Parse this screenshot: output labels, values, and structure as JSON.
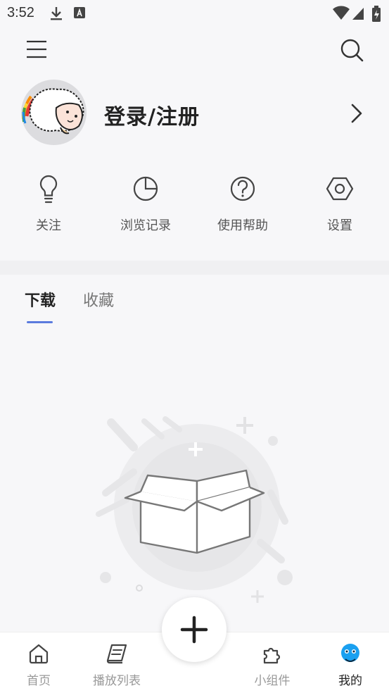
{
  "status_bar": {
    "time": "3:52"
  },
  "profile": {
    "login_label": "登录/注册"
  },
  "quick_actions": [
    {
      "label": "关注",
      "icon": "lightbulb-icon"
    },
    {
      "label": "浏览记录",
      "icon": "pie-chart-icon"
    },
    {
      "label": "使用帮助",
      "icon": "help-circle-icon"
    },
    {
      "label": "设置",
      "icon": "settings-hexagon-icon"
    }
  ],
  "tabs": [
    {
      "label": "下载",
      "active": true
    },
    {
      "label": "收藏",
      "active": false
    }
  ],
  "bottom_nav": [
    {
      "label": "首页",
      "icon": "home-icon",
      "active": false
    },
    {
      "label": "播放列表",
      "icon": "playlist-icon",
      "active": false
    },
    {
      "label": "小组件",
      "icon": "puzzle-icon",
      "active": false
    },
    {
      "label": "我的",
      "icon": "profile-face-icon",
      "active": true
    }
  ],
  "fab": {
    "icon": "plus-icon"
  },
  "colors": {
    "accent": "#5b7bde",
    "active_nav": "#1aa0f0",
    "background": "#f7f7f9"
  }
}
